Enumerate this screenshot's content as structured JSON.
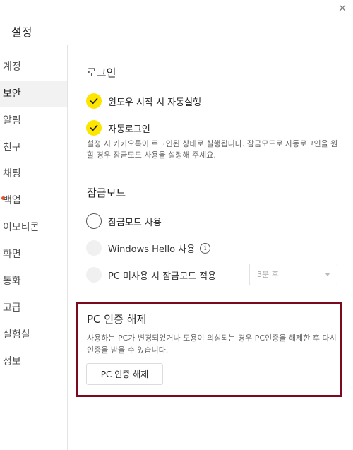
{
  "window": {
    "title": "설정",
    "close_glyph": "×"
  },
  "sidebar": {
    "items": [
      {
        "label": "계정"
      },
      {
        "label": "보안"
      },
      {
        "label": "알림"
      },
      {
        "label": "친구"
      },
      {
        "label": "채팅"
      },
      {
        "label": "백업"
      },
      {
        "label": "이모티콘"
      },
      {
        "label": "화면"
      },
      {
        "label": "통화"
      },
      {
        "label": "고급"
      },
      {
        "label": "실험실"
      },
      {
        "label": "정보"
      }
    ],
    "active": "보안"
  },
  "login": {
    "title": "로그인",
    "auto_start": {
      "label": "윈도우 시작 시 자동실행",
      "checked": true
    },
    "auto_login": {
      "label": "자동로그인",
      "checked": true
    },
    "description": "설정 시 카카오톡이 로그인된 상태로 실행됩니다. 잠금모드로 자동로그인을 원할 경우 잠금모드 사용을 설정해 주세요."
  },
  "lock_mode": {
    "title": "잠금모드",
    "use_lock": {
      "label": "잠금모드 사용",
      "checked": false
    },
    "windows_hello": {
      "label": "Windows Hello 사용",
      "info_glyph": "i",
      "enabled": false
    },
    "idle_lock": {
      "label": "PC 미사용 시 잠금모드 적용",
      "enabled": false
    },
    "idle_select": {
      "value": "3분 후"
    }
  },
  "pc_auth": {
    "title": "PC 인증 해제",
    "description": "사용하는 PC가 변경되었거나 도용이 의심되는 경우 PC인증을 해제한 후 다시 인증을 받을 수 있습니다.",
    "button_label": "PC 인증 해제"
  },
  "colors": {
    "accent": "#fee500",
    "highlight": "#7b0a1f",
    "notification": "#e8532f"
  }
}
